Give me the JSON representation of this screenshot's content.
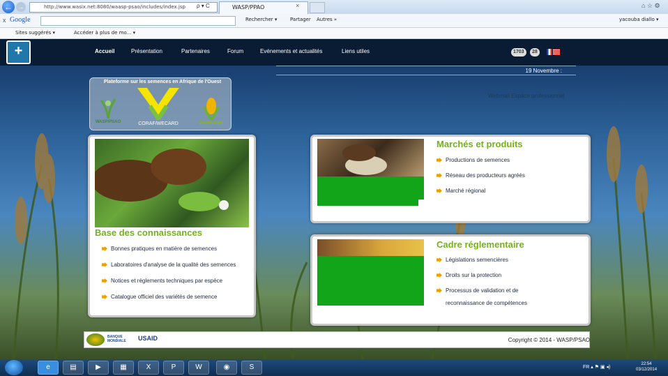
{
  "browser": {
    "address": "http://www.wasix.net:8080/waasp-psao/includes/index.jsp",
    "address_controls": "ρ ▾ C",
    "tab_title": "WASP/PPAO",
    "tab_close": "×",
    "window_controls": "⌂ ☆ ⚙",
    "google_x": "x",
    "google_label": "Google",
    "toolbar": {
      "search": "Rechercher ▾",
      "share": "Partager",
      "more": "Autres »"
    },
    "user": "yacouba diallo ▾",
    "favorites": {
      "suggested": "Sites suggérés ▾",
      "access": "Accéder à plus de mo... ▾"
    }
  },
  "nav": {
    "items": [
      "Accueil",
      "Présentation",
      "Partenaires",
      "Forum",
      "Evénements et actualités",
      "Liens utiles"
    ],
    "counter1": "1703",
    "counter2": "28"
  },
  "date_text": "19 Novembre :",
  "weblinks": "Webmail    Espace professionnel",
  "partners": {
    "title": "Plateforme sur les semences en Afrique de l'Ouest",
    "wasp": "WASP/PSAO",
    "coraf": "CORAF/WECARD",
    "ppao": "WAAPP/PPAO"
  },
  "cards": {
    "knowledge": {
      "title": "Base des connaissances",
      "links": [
        "Bonnes pratiques en matière de semences",
        "Laboratoires d'analyse de la qualité des semences",
        "Notices et réglements techniques par espèce",
        "Catalogue officiel des variétés de semence"
      ]
    },
    "markets": {
      "title": "Marchés et produits",
      "links": [
        "Productions de semences",
        "Réseau des producteurs agréés",
        "Marché régional"
      ]
    },
    "regulatory": {
      "title": "Cadre réglementaire",
      "links": [
        "Législations semencières",
        "Droits sur la protection",
        "Processus de validation et de",
        "reconnaissance de compétences"
      ]
    }
  },
  "footer": {
    "copyright": "Copyright © 2014 - WASP/PSAO",
    "banque": "BANQUE MONDIALE",
    "usaid": "USAID"
  },
  "taskbar": {
    "lang": "FR",
    "time": "22:54",
    "date": "03/12/2014"
  }
}
